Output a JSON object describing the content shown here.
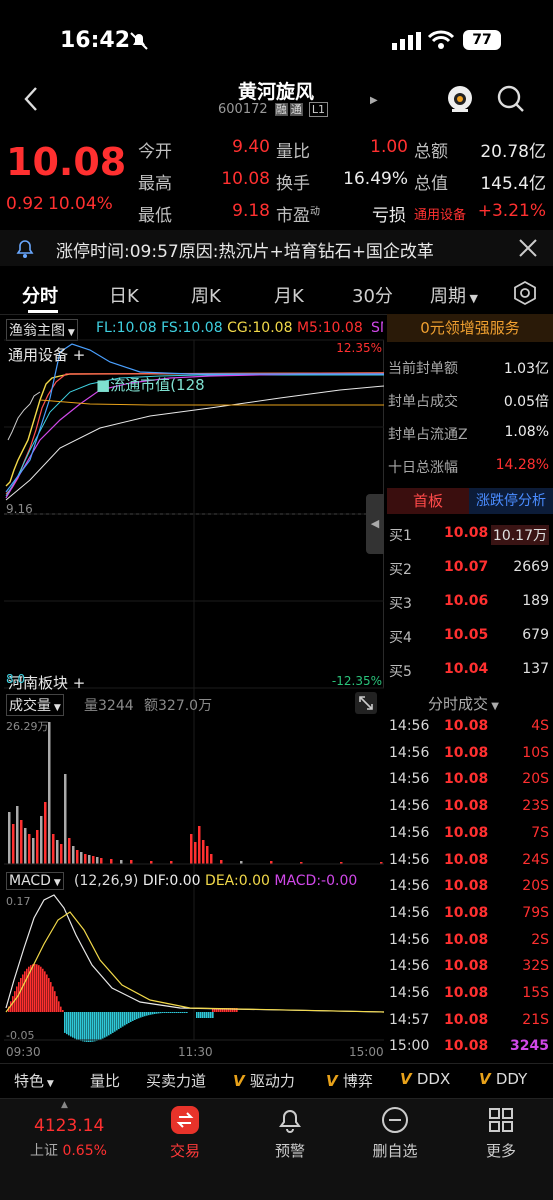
{
  "status_bar": {
    "time": "16:42",
    "battery": "77"
  },
  "header": {
    "name": "黄河旋风",
    "code": "600172",
    "badges": [
      "融",
      "通",
      "L1"
    ]
  },
  "quote": {
    "price": "10.08",
    "change": "0.92",
    "change_pct": "10.04%",
    "stats": [
      {
        "label": "今开",
        "value": "9.40",
        "color": "red"
      },
      {
        "label": "量比",
        "value": "1.00",
        "color": "red"
      },
      {
        "label": "总额",
        "value": "20.78亿",
        "color": "white"
      },
      {
        "label": "最高",
        "value": "10.08",
        "color": "red"
      },
      {
        "label": "换手",
        "value": "16.49%",
        "color": "white"
      },
      {
        "label": "总值",
        "value": "145.4亿",
        "color": "white"
      },
      {
        "label": "最低",
        "value": "9.18",
        "color": "red"
      },
      {
        "label": "市盈",
        "label_sup": "动",
        "value": "亏损",
        "color": "white"
      },
      {
        "label": "通用设备",
        "value": "+3.21%",
        "color": "red"
      }
    ]
  },
  "notice": {
    "text": "涨停时间:09:57原因:热沉片+培育钻石+国企改革"
  },
  "tabs": [
    "分时",
    "日K",
    "周K",
    "月K",
    "30分",
    "周期"
  ],
  "chart_legend": {
    "main_selector": "渔翁主图",
    "items": [
      {
        "text": "FL:10.08",
        "color": "#3fd0e0"
      },
      {
        "text": "FS:10.08",
        "color": "#3fd0e0"
      },
      {
        "text": "CG:10.08",
        "color": "#f2d94a"
      },
      {
        "text": "M5:10.08",
        "color": "#ff3030"
      },
      {
        "text": "SM",
        "color": "#d048e8"
      }
    ],
    "sector_top": "通用设备 +",
    "sector_bottom": "河南板块 +",
    "flow_label": "流通市值(128",
    "pct_top": "12.35%",
    "pct_bottom": "-12.35%",
    "price_low": "9.16",
    "price_open_left": "8.0"
  },
  "promo": {
    "text": "0元领增强服务"
  },
  "seal": [
    {
      "label": "当前封单额",
      "value": "1.03亿"
    },
    {
      "label": "封单占成交",
      "value": "0.05倍"
    },
    {
      "label": "封单占流通Z",
      "value": "1.08%"
    },
    {
      "label": "十日总涨幅",
      "value": "14.28%"
    }
  ],
  "board_tabs": [
    "首板",
    "涨跌停分析"
  ],
  "bids": [
    {
      "label": "买1",
      "price": "10.08",
      "vol": "10.17万"
    },
    {
      "label": "买2",
      "price": "10.07",
      "vol": "2669"
    },
    {
      "label": "买3",
      "price": "10.06",
      "vol": "189"
    },
    {
      "label": "买4",
      "price": "10.05",
      "vol": "679"
    },
    {
      "label": "买5",
      "price": "10.04",
      "vol": "137"
    }
  ],
  "volume_panel": {
    "selector": "成交量",
    "vol": "量3244",
    "amount": "额327.0万",
    "max": "26.29万"
  },
  "ticks_title": "分时成交",
  "ticks": [
    {
      "time": "14:56",
      "price": "10.08",
      "vol": "4S"
    },
    {
      "time": "14:56",
      "price": "10.08",
      "vol": "10S"
    },
    {
      "time": "14:56",
      "price": "10.08",
      "vol": "20S"
    },
    {
      "time": "14:56",
      "price": "10.08",
      "vol": "23S"
    },
    {
      "time": "14:56",
      "price": "10.08",
      "vol": "7S"
    },
    {
      "time": "14:56",
      "price": "10.08",
      "vol": "24S"
    },
    {
      "time": "14:56",
      "price": "10.08",
      "vol": "20S"
    },
    {
      "time": "14:56",
      "price": "10.08",
      "vol": "79S"
    },
    {
      "time": "14:56",
      "price": "10.08",
      "vol": "2S"
    },
    {
      "time": "14:56",
      "price": "10.08",
      "vol": "32S"
    },
    {
      "time": "14:56",
      "price": "10.08",
      "vol": "15S"
    },
    {
      "time": "14:57",
      "price": "10.08",
      "vol": "21S"
    },
    {
      "time": "15:00",
      "price": "10.08",
      "vol": "3245"
    }
  ],
  "macd": {
    "selector": "MACD",
    "params": "(12,26,9)",
    "dif": "DIF:0.00",
    "dea": "DEA:0.00",
    "macd": "MACD:-0.00",
    "max": "0.17",
    "min": "-0.05"
  },
  "time_axis": [
    "09:30",
    "11:30",
    "15:00"
  ],
  "toolbar": [
    "特色",
    "量比",
    "买卖力道",
    "驱动力",
    "博弈",
    "DDX",
    "DDY"
  ],
  "bottom_nav": {
    "index_value": "4123.14",
    "index_name": "上证",
    "index_pct": "0.65%",
    "items": [
      "交易",
      "预警",
      "删自选",
      "更多"
    ]
  },
  "colors": {
    "up": "#ff3030",
    "down": "#2ac27a",
    "accent": "#e8a21a"
  }
}
